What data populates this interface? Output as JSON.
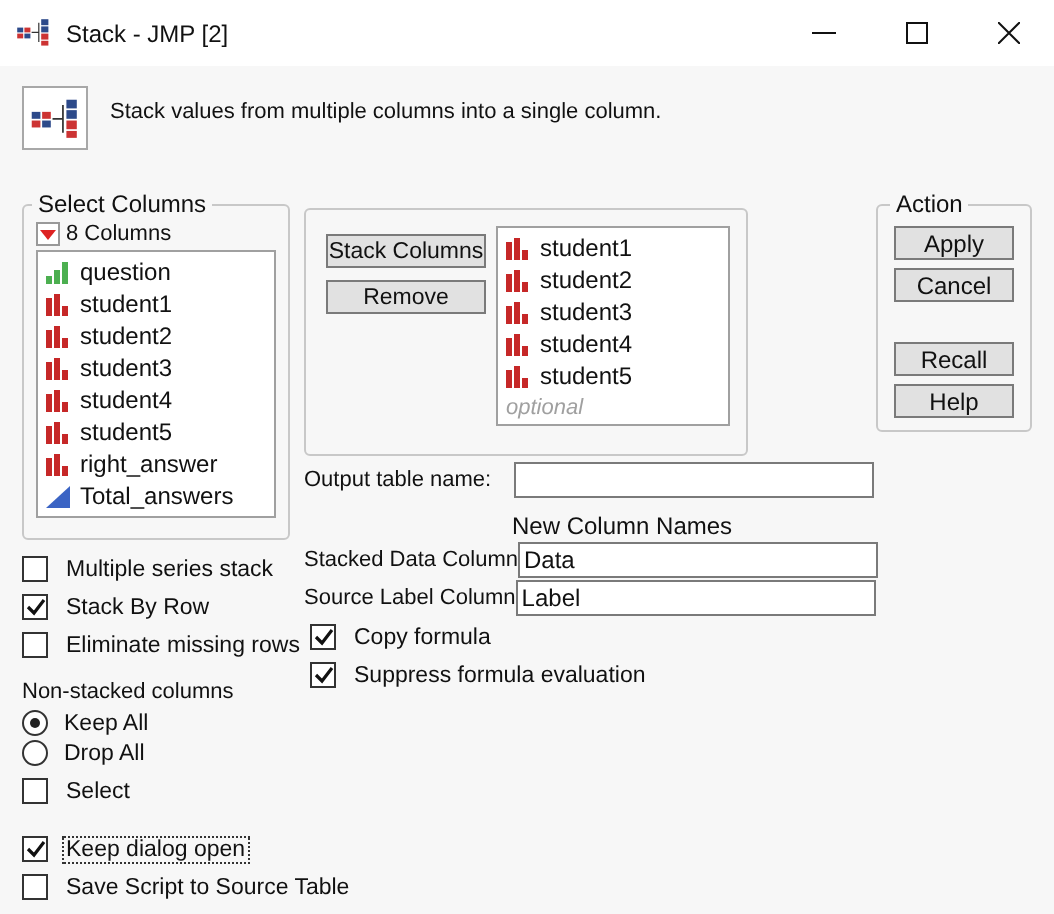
{
  "window": {
    "title": "Stack - JMP [2]"
  },
  "header": {
    "description": "Stack values from multiple columns into a single column."
  },
  "select_columns": {
    "title": "Select Columns",
    "count_label": "8 Columns",
    "columns": [
      {
        "name": "question",
        "kind": "ordinal"
      },
      {
        "name": "student1",
        "kind": "nominal"
      },
      {
        "name": "student2",
        "kind": "nominal"
      },
      {
        "name": "student3",
        "kind": "nominal"
      },
      {
        "name": "student4",
        "kind": "nominal"
      },
      {
        "name": "student5",
        "kind": "nominal"
      },
      {
        "name": "right_answer",
        "kind": "nominal"
      },
      {
        "name": "Total_answers",
        "kind": "continuous"
      }
    ]
  },
  "stack_panel": {
    "buttons": [
      "Stack Columns",
      "Remove"
    ],
    "columns": [
      {
        "name": "student1",
        "kind": "nominal"
      },
      {
        "name": "student2",
        "kind": "nominal"
      },
      {
        "name": "student3",
        "kind": "nominal"
      },
      {
        "name": "student4",
        "kind": "nominal"
      },
      {
        "name": "student5",
        "kind": "nominal"
      }
    ],
    "placeholder": "optional"
  },
  "action": {
    "title": "Action",
    "buttons": [
      "Apply",
      "Cancel",
      "Recall",
      "Help"
    ]
  },
  "output_table": {
    "label": "Output table name:"
  },
  "new_column_names": {
    "heading": "New Column Names",
    "fields": [
      {
        "label": "Stacked Data Column",
        "value": "Data"
      },
      {
        "label": "Source Label Column",
        "value": "Label"
      }
    ]
  },
  "stack_options": [
    {
      "label": "Multiple series stack",
      "checked": false
    },
    {
      "label": "Stack By Row",
      "checked": true
    },
    {
      "label": "Eliminate missing rows",
      "checked": false
    }
  ],
  "formula_options": [
    {
      "label": "Copy formula",
      "checked": true
    },
    {
      "label": "Suppress formula evaluation",
      "checked": true
    }
  ],
  "non_stacked": {
    "title": "Non-stacked columns",
    "radios": [
      {
        "label": "Keep All",
        "selected": true
      },
      {
        "label": "Drop All",
        "selected": false
      }
    ],
    "select": {
      "label": "Select",
      "checked": false
    }
  },
  "footer_options": [
    {
      "label": "Keep dialog open",
      "checked": true,
      "focused": true
    },
    {
      "label": "Save Script to Source Table",
      "checked": false,
      "focused": false
    }
  ]
}
